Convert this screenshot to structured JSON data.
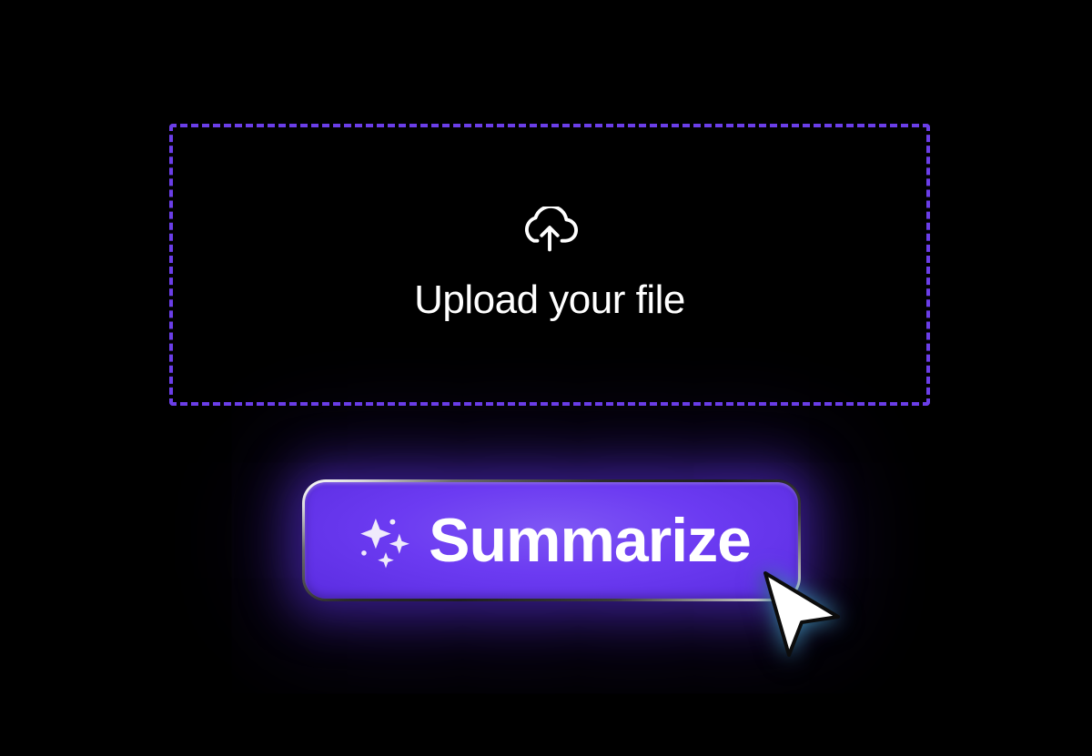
{
  "upload": {
    "label": "Upload your file",
    "icon": "cloud-upload-icon"
  },
  "action": {
    "label": "Summarize",
    "icon": "sparkles-icon"
  },
  "colors": {
    "accent": "#6B3EE8",
    "button_fill": "#6236EE",
    "text": "#FFFFFF",
    "background": "#000000"
  }
}
